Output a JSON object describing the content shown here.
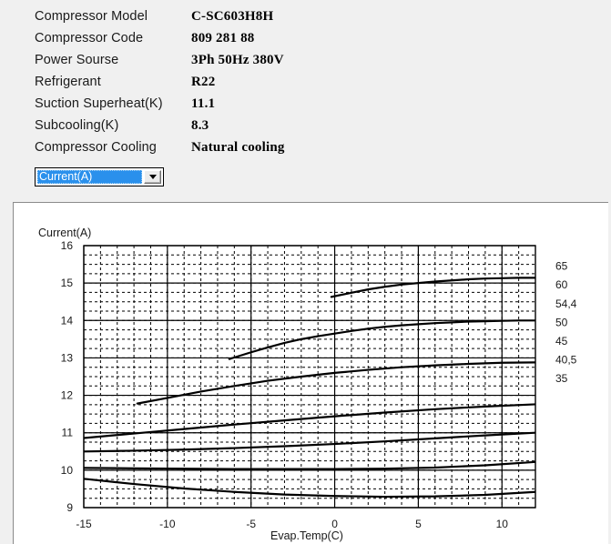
{
  "spec": {
    "rows": [
      {
        "label": "Compressor  Model",
        "value": "C-SC603H8H"
      },
      {
        "label": "Compressor Code",
        "value": "809 281 88"
      },
      {
        "label": "Power Sourse",
        "value": "3Ph  50Hz  380V"
      },
      {
        "label": "Refrigerant",
        "value": "R22"
      },
      {
        "label": "Suction Superheat(K)",
        "value": "11.1"
      },
      {
        "label": "Subcooling(K)",
        "value": "8.3"
      },
      {
        "label": "Compressor Cooling",
        "value": "Natural cooling"
      }
    ]
  },
  "chart_select": {
    "selected": "Current(A)",
    "options": [
      "Current(A)"
    ],
    "arrow_icon": "chevron-down-icon",
    "highlight_color": "#2a90ec"
  },
  "chart_data": {
    "type": "line",
    "title": "Current(A)",
    "xlabel": "Evap.Temp(C)",
    "ylabel": "Current(A)",
    "xlim": [
      -15,
      12
    ],
    "ylim": [
      9,
      16
    ],
    "xticks": [
      -15,
      -10,
      -5,
      0,
      5,
      10
    ],
    "yticks": [
      9,
      10,
      11,
      12,
      13,
      14,
      15,
      16
    ],
    "grid": "major solid, minor dashed",
    "minor_x_step": 1,
    "minor_y_step": 0.25,
    "legend": "right-side condensing temperature labels",
    "series_unit_x": "Evap.Temp(C)",
    "series_unit_y": "Current(A)",
    "series": [
      {
        "name": "65",
        "label": "65",
        "label_y_value": 15.45,
        "x": [
          -0.2,
          1,
          2,
          3,
          4,
          5,
          6,
          7,
          8,
          9,
          10,
          11,
          12
        ],
        "values": [
          14.63,
          14.74,
          14.83,
          14.9,
          14.96,
          15.0,
          15.04,
          15.07,
          15.1,
          15.12,
          15.13,
          15.14,
          15.14
        ]
      },
      {
        "name": "60",
        "label": "60",
        "label_y_value": 14.95,
        "x": [
          -6.3,
          -5,
          -4,
          -3,
          -2,
          -1,
          0,
          1,
          2,
          3,
          4,
          5,
          6,
          7,
          8,
          9,
          10,
          11,
          12
        ],
        "values": [
          12.97,
          13.15,
          13.28,
          13.4,
          13.5,
          13.58,
          13.65,
          13.72,
          13.78,
          13.83,
          13.87,
          13.9,
          13.93,
          13.95,
          13.97,
          13.98,
          13.99,
          14.0,
          14.0
        ]
      },
      {
        "name": "54,4",
        "label": "54,4",
        "label_y_value": 14.45,
        "x": [
          -11.8,
          -10,
          -8,
          -6,
          -4,
          -2,
          0,
          2,
          4,
          6,
          8,
          10,
          12
        ],
        "values": [
          11.78,
          11.93,
          12.1,
          12.25,
          12.39,
          12.5,
          12.6,
          12.68,
          12.75,
          12.8,
          12.84,
          12.87,
          12.88
        ]
      },
      {
        "name": "50",
        "label": "50",
        "label_y_value": 13.95,
        "x": [
          -15,
          -12,
          -9,
          -6,
          -3,
          0,
          3,
          6,
          9,
          12
        ],
        "values": [
          10.86,
          10.98,
          11.1,
          11.22,
          11.33,
          11.44,
          11.54,
          11.63,
          11.7,
          11.76
        ]
      },
      {
        "name": "45",
        "label": "45",
        "label_y_value": 13.45,
        "x": [
          -15,
          -12,
          -9,
          -6,
          -3,
          0,
          3,
          6,
          9,
          12
        ],
        "values": [
          10.5,
          10.52,
          10.55,
          10.59,
          10.64,
          10.7,
          10.77,
          10.85,
          10.93,
          11.0
        ]
      },
      {
        "name": "40,5",
        "label": "40,5",
        "label_y_value": 12.95,
        "x": [
          -15,
          -12,
          -9,
          -6,
          -3,
          0,
          3,
          6,
          9,
          12
        ],
        "values": [
          10.06,
          10.05,
          10.04,
          10.03,
          10.03,
          10.03,
          10.04,
          10.07,
          10.13,
          10.22
        ]
      },
      {
        "name": "35",
        "label": "35",
        "label_y_value": 12.45,
        "x": [
          -15,
          -12,
          -9,
          -6,
          -3,
          0,
          3,
          6,
          9,
          12
        ],
        "values": [
          9.77,
          9.63,
          9.51,
          9.42,
          9.35,
          9.31,
          9.29,
          9.3,
          9.34,
          9.42
        ]
      }
    ]
  }
}
